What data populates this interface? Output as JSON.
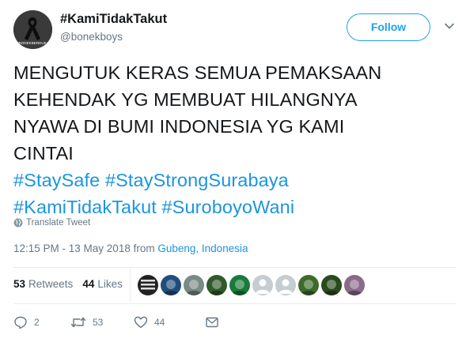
{
  "author": {
    "display_name": "#KamiTidakTakut",
    "handle": "@bonekboys",
    "avatar_caption": "#BONEKBERDUKA"
  },
  "header": {
    "follow_label": "Follow",
    "more_icon": "chevron-down-icon"
  },
  "tweet": {
    "lines": [
      "MENGUTUK KERAS SEMUA PEMAKSAAN",
      "KEHENDAK YG MEMBUAT HILANGNYA",
      "NYAWA DI BUMI INDONESIA YG KAMI",
      "CINTAI"
    ],
    "hashtags": [
      "#StaySafe",
      "#StayStrongSurabaya",
      "#KamiTidakTakut",
      "#SuroboyoWani"
    ]
  },
  "translate": {
    "label": "Translate Tweet",
    "icon": "globe-icon"
  },
  "meta": {
    "timestamp": "12:15 PM - 13 May 2018",
    "from_word": "from",
    "location": "Gubeng, Indonesia"
  },
  "stats": {
    "retweets_count": "53",
    "retweets_label": "Retweets",
    "likes_count": "44",
    "likes_label": "Likes"
  },
  "likers": [
    {
      "name": "liker-1",
      "color": "#222222",
      "kind": "text",
      "text": "BONEK"
    },
    {
      "name": "liker-2",
      "color": "#1f4e7a",
      "kind": "photo"
    },
    {
      "name": "liker-3",
      "color": "#7a8a84",
      "kind": "photo"
    },
    {
      "name": "liker-4",
      "color": "#2f5a2a",
      "kind": "photo"
    },
    {
      "name": "liker-5",
      "color": "#1a7a3a",
      "kind": "photo"
    },
    {
      "name": "liker-6",
      "color": "#c5ccd2",
      "kind": "default"
    },
    {
      "name": "liker-7",
      "color": "#c5ccd2",
      "kind": "default"
    },
    {
      "name": "liker-8",
      "color": "#3c6b2a",
      "kind": "photo"
    },
    {
      "name": "liker-9",
      "color": "#2a4a1e",
      "kind": "photo"
    },
    {
      "name": "liker-10",
      "color": "#8a6a8a",
      "kind": "photo"
    }
  ],
  "actions": {
    "reply_count": "2",
    "retweet_count": "53",
    "like_count": "44"
  },
  "colors": {
    "accent": "#1da1f2",
    "link": "#1b95e0",
    "text": "#14171a",
    "secondary": "#657786",
    "divider": "#e6ecf0"
  }
}
